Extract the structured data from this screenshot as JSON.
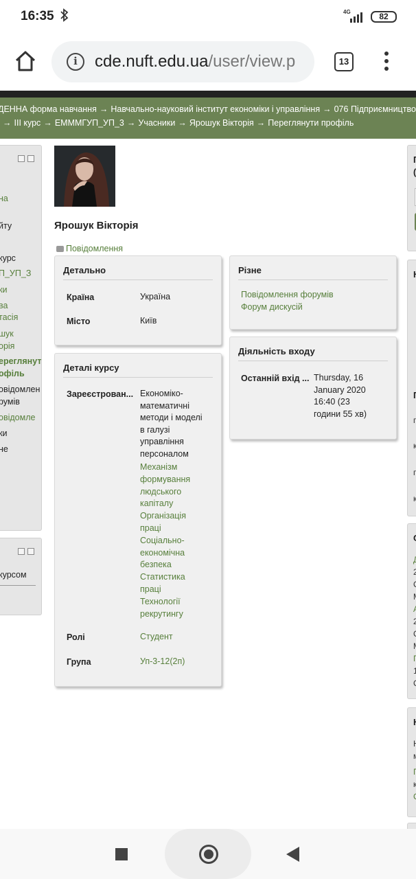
{
  "status": {
    "time": "16:35",
    "network": "4G",
    "battery": "82"
  },
  "browser": {
    "url_host": "cde.nuft.edu.ua",
    "url_path": "/user/view.p",
    "tab_count": "13"
  },
  "breadcrumb": {
    "row1": [
      "ДЕННА форма навчання",
      "Навчально-науковий інститут економіки і управління",
      "076 Підприємництво"
    ],
    "row2": [
      "ІІІ курс",
      "ЕММMГУП_УП_3",
      "Учасники",
      "Ярошук Вікторія",
      "Переглянути профіль"
    ]
  },
  "left_nav": {
    "items": [
      "на",
      "йту",
      "курс",
      "П_УП_З",
      "ки",
      "ва",
      "тасія",
      "шук",
      "орія",
      "ереглянут",
      "офіль",
      "овідомлен",
      "румів",
      "овідомле",
      "ки",
      "не"
    ],
    "block2": {
      "items": [
        "курсом"
      ]
    }
  },
  "right_column": {
    "letters": [
      "П",
      "(",
      "Н",
      "П",
      "С",
      "Н"
    ],
    "snippets": [
      "п",
      "к",
      "п",
      "к",
      "Д",
      "2",
      "С",
      "М",
      "А",
      "2",
      "С",
      "М",
      "П",
      "1",
      "С",
      "Н",
      "м",
      "П",
      "к",
      "С"
    ]
  },
  "profile": {
    "name": "Ярошук Вікторія",
    "message_link": "Повідомлення"
  },
  "details": {
    "title": "Детально",
    "country_label": "Країна",
    "country_value": "Україна",
    "city_label": "Місто",
    "city_value": "Київ"
  },
  "course_details": {
    "title": "Деталі курсу",
    "enrolled_label": "Зареєстрован...",
    "courses_first": [
      "Економіко-",
      "математичні",
      "методи і моделі",
      "в галузі",
      "управління",
      "персоналом"
    ],
    "courses_links": [
      "Механізм",
      "формування",
      "людського",
      "капіталу",
      "Організація",
      "праці",
      "Соціально-",
      "економічна",
      "безпека",
      "Статистика",
      "праці",
      "Технології",
      "рекрутингу"
    ],
    "roles_label": "Ролі",
    "roles_value": "Студент",
    "group_label": "Група",
    "group_value": "Уп-3-12(2п)"
  },
  "misc": {
    "title": "Різне",
    "links": [
      "Повідомлення форумів",
      "Форум дискусій"
    ]
  },
  "login_activity": {
    "title": "Діяльність входу",
    "last_login_label": "Останній вхід ...",
    "last_login_lines": [
      "Thursday, 16",
      "January 2020",
      "16:40  (23",
      "години 55 хв)"
    ]
  },
  "colors": {
    "accent": "#6c8354",
    "link": "#567e3a"
  }
}
